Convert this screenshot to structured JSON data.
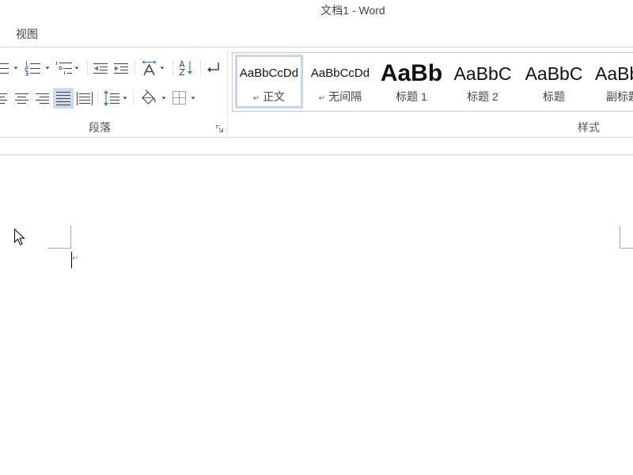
{
  "window": {
    "title": "文档1 - Word"
  },
  "tabs": [
    {
      "label": "视图"
    }
  ],
  "ribbon": {
    "paragraph": {
      "label": "段落",
      "row1": [
        {
          "icon": "bullets-icon",
          "has_dropdown": true
        },
        {
          "icon": "numbering-icon",
          "has_dropdown": true
        },
        {
          "icon": "multilevel-list-icon",
          "has_dropdown": true
        },
        {
          "icon": "decrease-indent-icon",
          "has_dropdown": false
        },
        {
          "icon": "increase-indent-icon",
          "has_dropdown": false
        },
        {
          "icon": "asian-layout-icon",
          "has_dropdown": true
        },
        {
          "icon": "sort-icon",
          "has_dropdown": false
        },
        {
          "icon": "show-hide-marks-icon",
          "has_dropdown": false
        }
      ],
      "row2": [
        {
          "icon": "align-left-icon",
          "pressed": false
        },
        {
          "icon": "align-center-icon",
          "pressed": false
        },
        {
          "icon": "align-right-icon",
          "pressed": false
        },
        {
          "icon": "justify-icon",
          "pressed": true
        },
        {
          "icon": "distribute-icon",
          "pressed": false
        },
        {
          "icon": "line-spacing-icon",
          "has_dropdown": true
        },
        {
          "icon": "shading-icon",
          "has_dropdown": true
        },
        {
          "icon": "borders-icon",
          "has_dropdown": true
        }
      ]
    },
    "styles": {
      "label": "样式",
      "items": [
        {
          "sample": "AaBbCcDd",
          "mark": "↵",
          "name": "正文",
          "selected": true
        },
        {
          "sample": "AaBbCcDd",
          "mark": "↵",
          "name": "无间隔"
        },
        {
          "sample": "AaBb",
          "name": "标题 1"
        },
        {
          "sample": "AaBbC",
          "name": "标题 2"
        },
        {
          "sample": "AaBbC",
          "name": "标题"
        },
        {
          "sample": "AaBbC",
          "name": "副标题"
        }
      ]
    }
  },
  "document": {
    "paragraph_mark": "↵"
  },
  "colors": {
    "text": "#444444",
    "accent_blue": "#3c7fc6",
    "pressed_button_bg": "#c9dcf4",
    "selected_style_border": "#c4d7f0",
    "gallery_border": "#c6c6c6"
  }
}
